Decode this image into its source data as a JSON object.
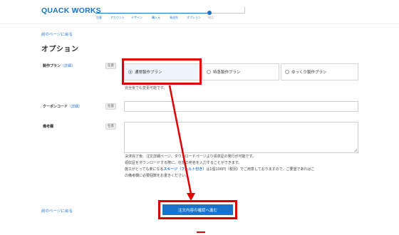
{
  "header": {
    "logo": "QUACK WORKS",
    "steps": [
      {
        "label": "注意",
        "done": true
      },
      {
        "label": "アカウント",
        "done": true
      },
      {
        "label": "デザイン",
        "done": true
      },
      {
        "label": "購入元",
        "done": true
      },
      {
        "label": "発送先",
        "done": true
      },
      {
        "label": "オプション",
        "done": true
      },
      {
        "label": "確認",
        "done": false
      }
    ]
  },
  "back_link_top": "前のページに戻る",
  "page_title": "オプション",
  "plan": {
    "label": "製作プラン",
    "detail": "（詳細）",
    "badge": "任意",
    "options": [
      {
        "label": "通常製作プラン",
        "selected": true
      },
      {
        "label": "特急製作プラン",
        "selected": false
      },
      {
        "label": "ゆっくり製作プラン",
        "selected": false
      }
    ],
    "note": "完全後でも変更可能です。"
  },
  "coupon": {
    "label": "クーポンコード",
    "detail": "（詳細）",
    "badge": "任意",
    "value": ""
  },
  "remarks": {
    "label": "備考欄",
    "badge": "任意",
    "value": "",
    "description_lines": [
      {
        "text": "決済完了後、注文詳細ページ、ダウンロードページより領収証の発行が可能です。"
      },
      {
        "text": "領収証をダウンロードする際に、任意の宛名を入力することができます。"
      },
      {
        "before": "施工がとっても楽になる",
        "highlight": "スキージ（フェルト付き）",
        "after": "は1個100円（税別）でご用意しておりますので、ご要望であればこ"
      },
      {
        "text": "の備考欄に必要個数をお書きください。"
      }
    ]
  },
  "back_link_bottom": "前のページに戻る",
  "submit_label": "注文内容の確認へ進む"
}
